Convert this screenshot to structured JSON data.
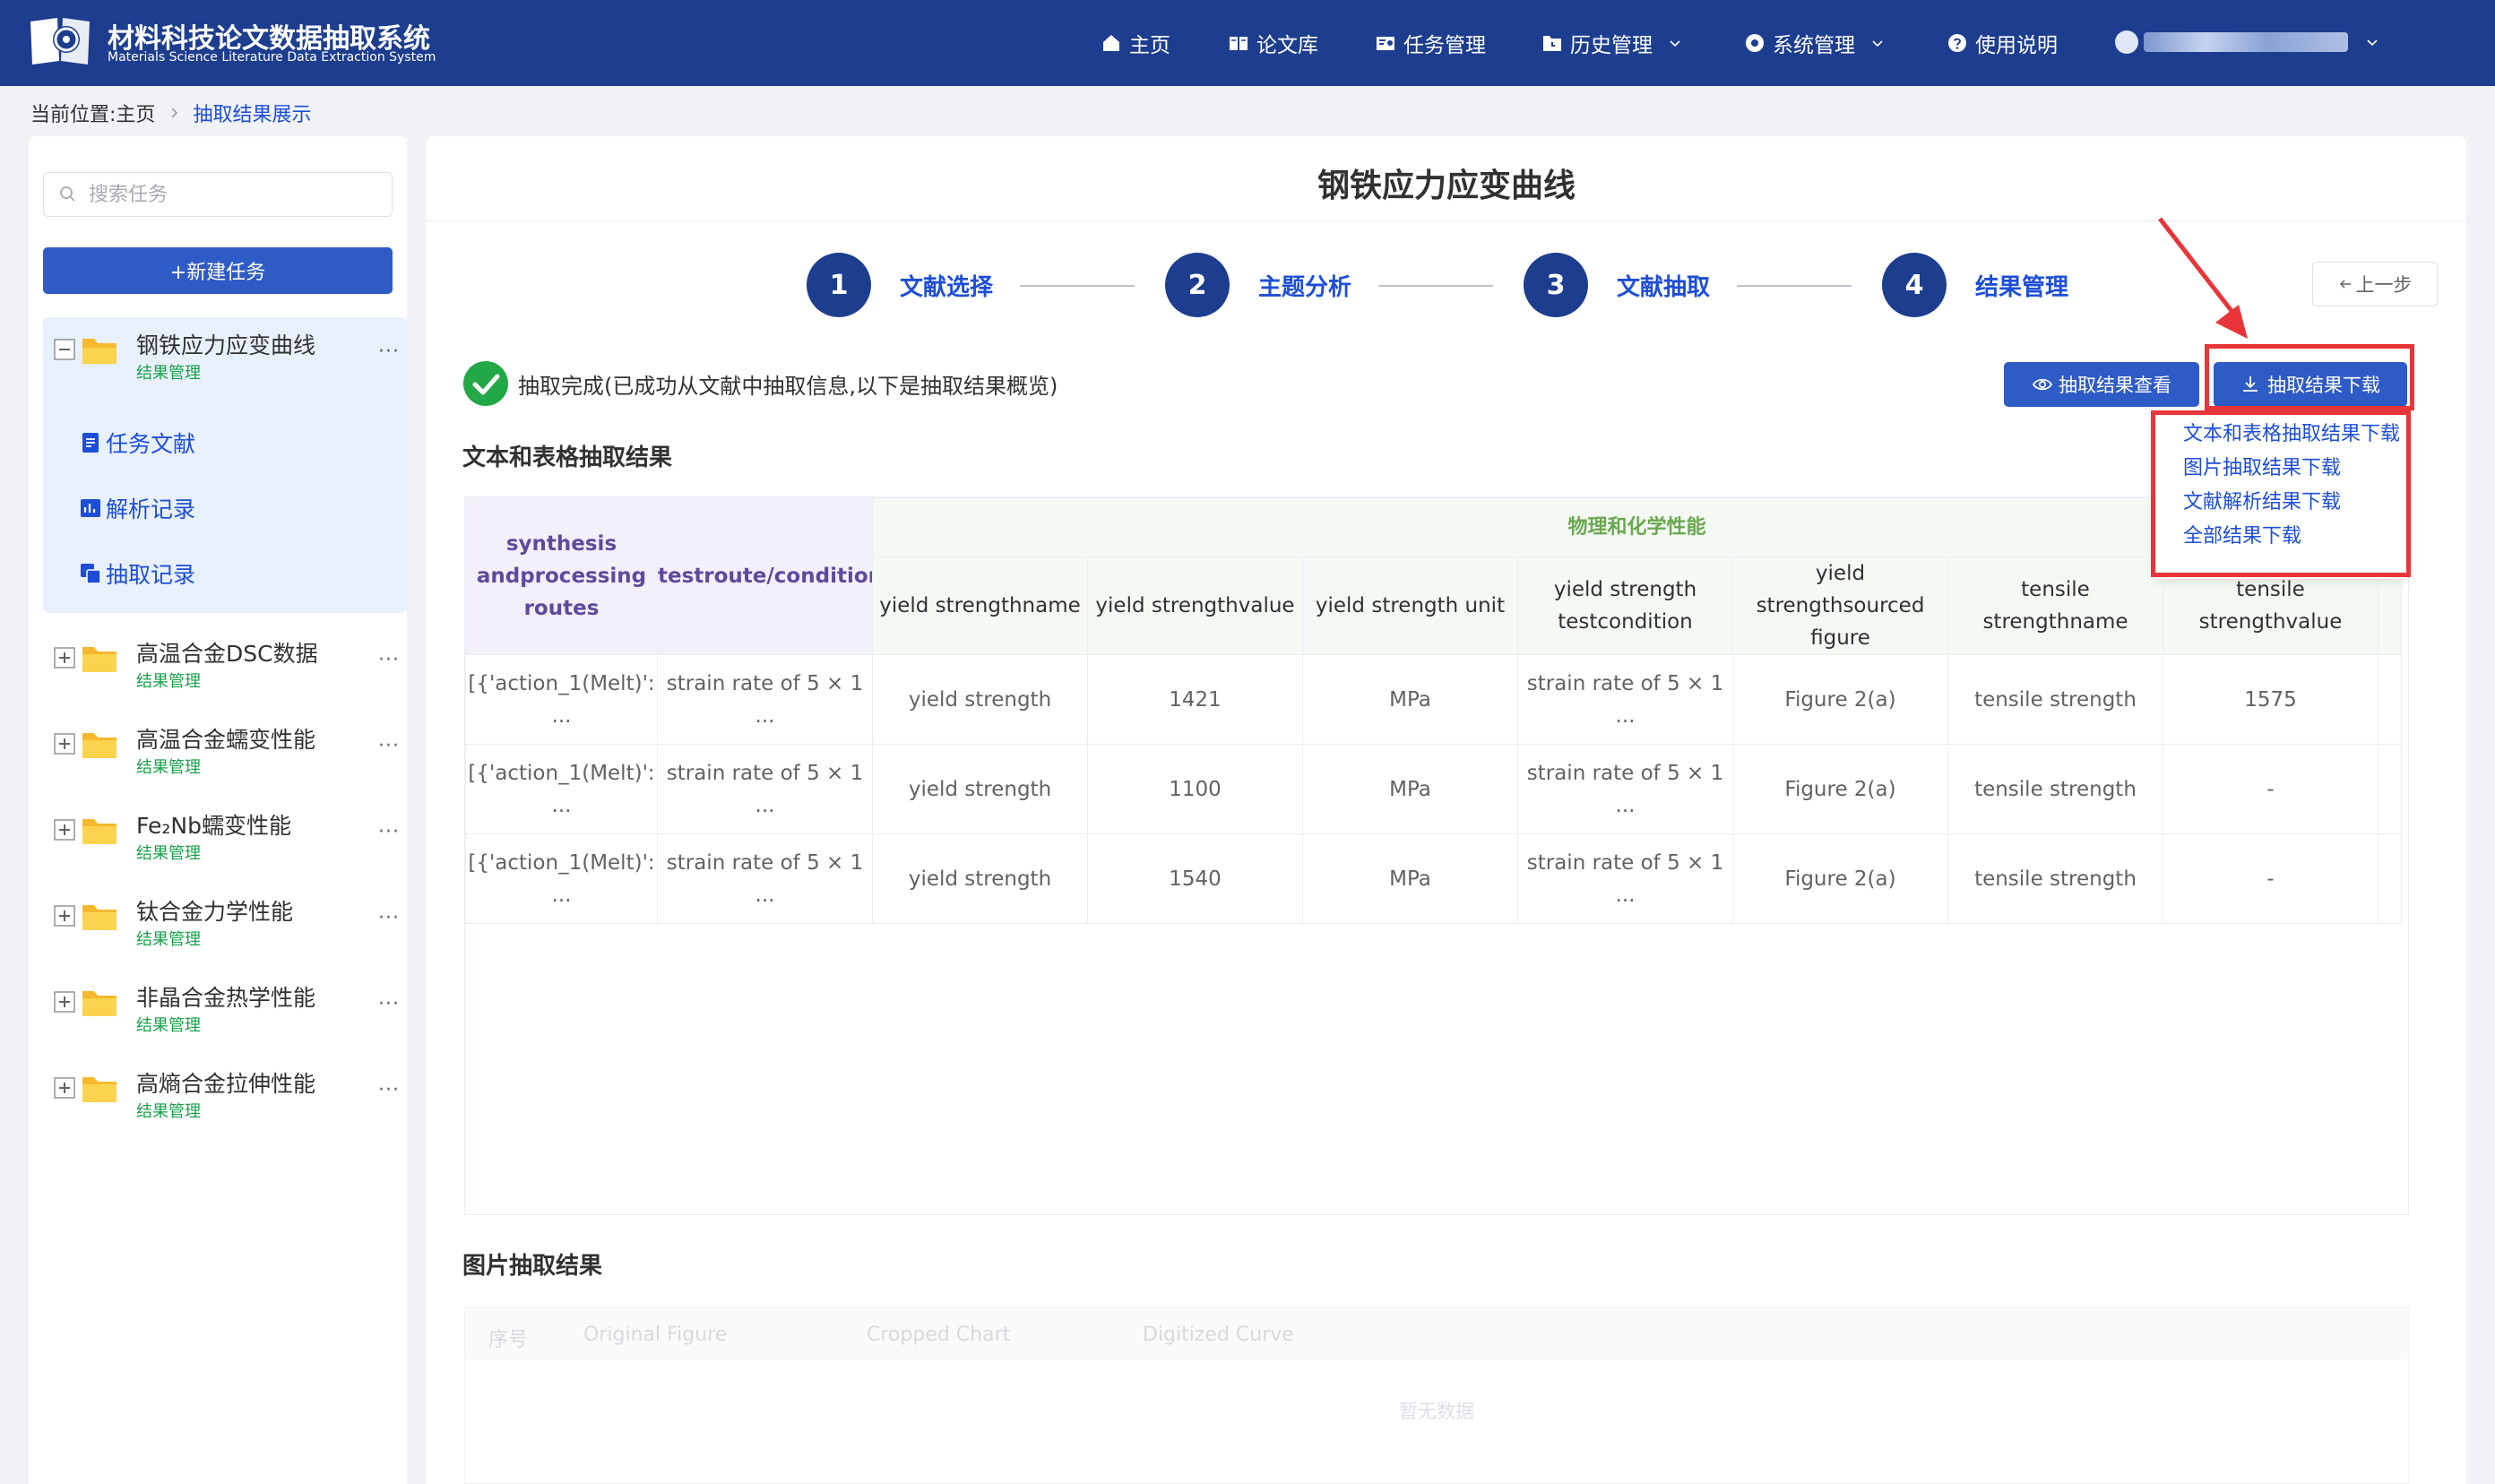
{
  "header": {
    "brand_cn": "材料科技论文数据抽取系统",
    "brand_en": "Materials Science Literature Data Extraction System",
    "nav": {
      "home": "主页",
      "library": "论文库",
      "tasks": "任务管理",
      "history": "历史管理",
      "system": "系统管理",
      "help": "使用说明"
    }
  },
  "breadcrumb": {
    "prefix": "当前位置:",
    "home": "主页",
    "current": "抽取结果展示"
  },
  "sidebar": {
    "search_placeholder": "搜索任务",
    "new_task": "+新建任务",
    "active": {
      "name": "钢铁应力应变曲线",
      "sub": "结果管理",
      "children": [
        "任务文献",
        "解析记录",
        "抽取记录"
      ]
    },
    "tasks": [
      {
        "name": "高温合金DSC数据",
        "sub": "结果管理"
      },
      {
        "name": "高温合金蠕变性能",
        "sub": "结果管理"
      },
      {
        "name": "Fe₂Nb蠕变性能",
        "sub": "结果管理"
      },
      {
        "name": "钛合金力学性能",
        "sub": "结果管理"
      },
      {
        "name": "非晶合金热学性能",
        "sub": "结果管理"
      },
      {
        "name": "高熵合金拉伸性能",
        "sub": "结果管理"
      }
    ],
    "more": "···"
  },
  "main": {
    "title": "钢铁应力应变曲线",
    "steps": [
      {
        "num": "1",
        "label": "文献选择"
      },
      {
        "num": "2",
        "label": "主题分析"
      },
      {
        "num": "3",
        "label": "文献抽取"
      },
      {
        "num": "4",
        "label": "结果管理"
      }
    ],
    "prev": "上一步",
    "status": "抽取完成(已成功从文献中抽取信息,以下是抽取结果概览)",
    "view_btn": "抽取结果查看",
    "download_btn": "抽取结果下载",
    "download_menu": [
      "文本和表格抽取结果下载",
      "图片抽取结果下载",
      "文献解析结果下载",
      "全部结果下载"
    ],
    "text_section": "文本和表格抽取结果",
    "table": {
      "col_synthesis": [
        "synthesis and",
        "processing routes"
      ],
      "col_test": [
        "test",
        "route/condition"
      ],
      "group": "物理和化学性能",
      "sub_headers": [
        [
          "yield strength",
          "name"
        ],
        [
          "yield strength",
          "value"
        ],
        [
          "yield strength unit"
        ],
        [
          "yield strength test",
          "condition"
        ],
        [
          "yield strength",
          "sourced figure"
        ],
        [
          "tensile strength",
          "name"
        ],
        [
          "tensile strength",
          "value"
        ]
      ],
      "rows": [
        {
          "synthesis": "[{'action_1(Melt)':",
          "test": "strain rate of 5 × 1",
          "ys_name": "yield strength",
          "ys_value": "1421",
          "ys_unit": "MPa",
          "ys_cond": "strain rate of 5 × 1",
          "ys_fig": "Figure 2(a)",
          "ts_name": "tensile strength",
          "ts_value": "1575"
        },
        {
          "synthesis": "[{'action_1(Melt)':",
          "test": "strain rate of 5 × 1",
          "ys_name": "yield strength",
          "ys_value": "1100",
          "ys_unit": "MPa",
          "ys_cond": "strain rate of 5 × 1",
          "ys_fig": "Figure 2(a)",
          "ts_name": "tensile strength",
          "ts_value": "-"
        },
        {
          "synthesis": "[{'action_1(Melt)':",
          "test": "strain rate of 5 × 1",
          "ys_name": "yield strength",
          "ys_value": "1540",
          "ys_unit": "MPa",
          "ys_cond": "strain rate of 5 × 1",
          "ys_fig": "Figure 2(a)",
          "ts_name": "tensile strength",
          "ts_value": "-"
        }
      ],
      "ellipsis": "..."
    },
    "image_section": "图片抽取结果",
    "image_table": {
      "headers": [
        "序号",
        "Original Figure",
        "Cropped Chart",
        "Digitized Curve"
      ],
      "empty": "暂无数据"
    }
  },
  "colors": {
    "header_bg": "#1d3d8f",
    "primary": "#2f5bc7",
    "link": "#1d4ed8",
    "success": "#17a34a",
    "highlight": "#e8353a",
    "group_header": "#6aa84f"
  }
}
